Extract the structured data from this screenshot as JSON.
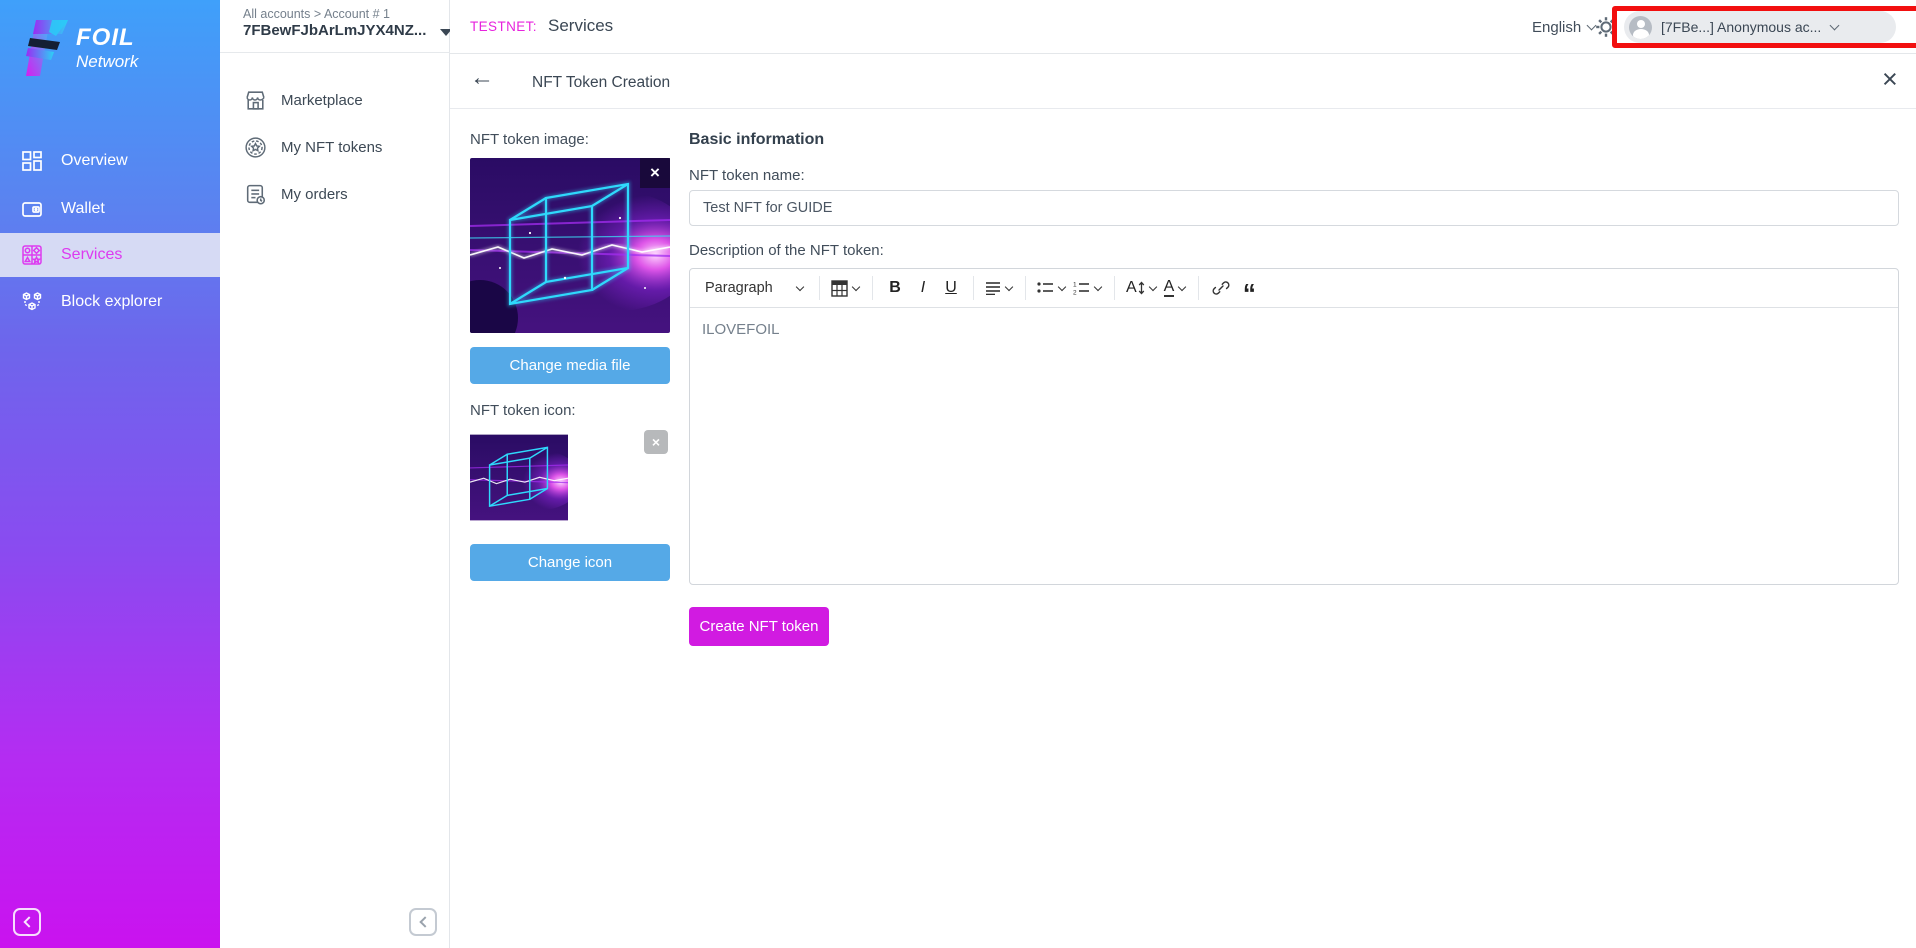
{
  "brand": {
    "line1": "FOIL",
    "line2": "Network"
  },
  "sidebar": {
    "items": [
      {
        "label": "Overview",
        "icon": "grid-icon",
        "active": false
      },
      {
        "label": "Wallet",
        "icon": "wallet-icon",
        "active": false
      },
      {
        "label": "Services",
        "icon": "shapes-grid-icon",
        "active": true
      },
      {
        "label": "Block explorer",
        "icon": "cubes-icon",
        "active": false
      }
    ]
  },
  "account_panel": {
    "breadcrumb": "All accounts > Account # 1",
    "account_id": "7FBewFJbArLmJYX4NZ...",
    "items": [
      {
        "label": "Marketplace",
        "icon": "storefront-icon"
      },
      {
        "label": "My NFT tokens",
        "icon": "token-medal-icon"
      },
      {
        "label": "My orders",
        "icon": "order-list-icon"
      }
    ]
  },
  "topbar": {
    "network_label": "TESTNET:",
    "page_title": "Services",
    "language": "English",
    "account_chip": "[7FBe...] Anonymous ac...",
    "annotation_color": "#f20f0f"
  },
  "page": {
    "title": "NFT Token Creation"
  },
  "form": {
    "image_label": "NFT token image:",
    "change_media_button": "Change media file",
    "icon_label": "NFT token icon:",
    "change_icon_button": "Change icon",
    "section_title": "Basic information",
    "name_label": "NFT token name:",
    "name_value": "Test NFT for GUIDE",
    "description_label": "Description of the NFT token:",
    "description_value": "ILOVEFOIL",
    "submit_button": "Create NFT token"
  },
  "editor_toolbar": {
    "paragraph": "Paragraph",
    "bold": "B",
    "italic": "I",
    "underline": "U",
    "font_size_letter": "A",
    "font_color_letter": "A",
    "quote_glyph": "“"
  },
  "glyphs": {
    "close": "×",
    "back": "←"
  },
  "colors": {
    "accent_magenta": "#d11be1",
    "button_blue": "#55a9e7",
    "testnet_magenta": "#e723dd",
    "active_item_text": "#dd3af0",
    "sidebar_top": "#3fa0fa",
    "sidebar_bottom": "#ca12ef"
  }
}
